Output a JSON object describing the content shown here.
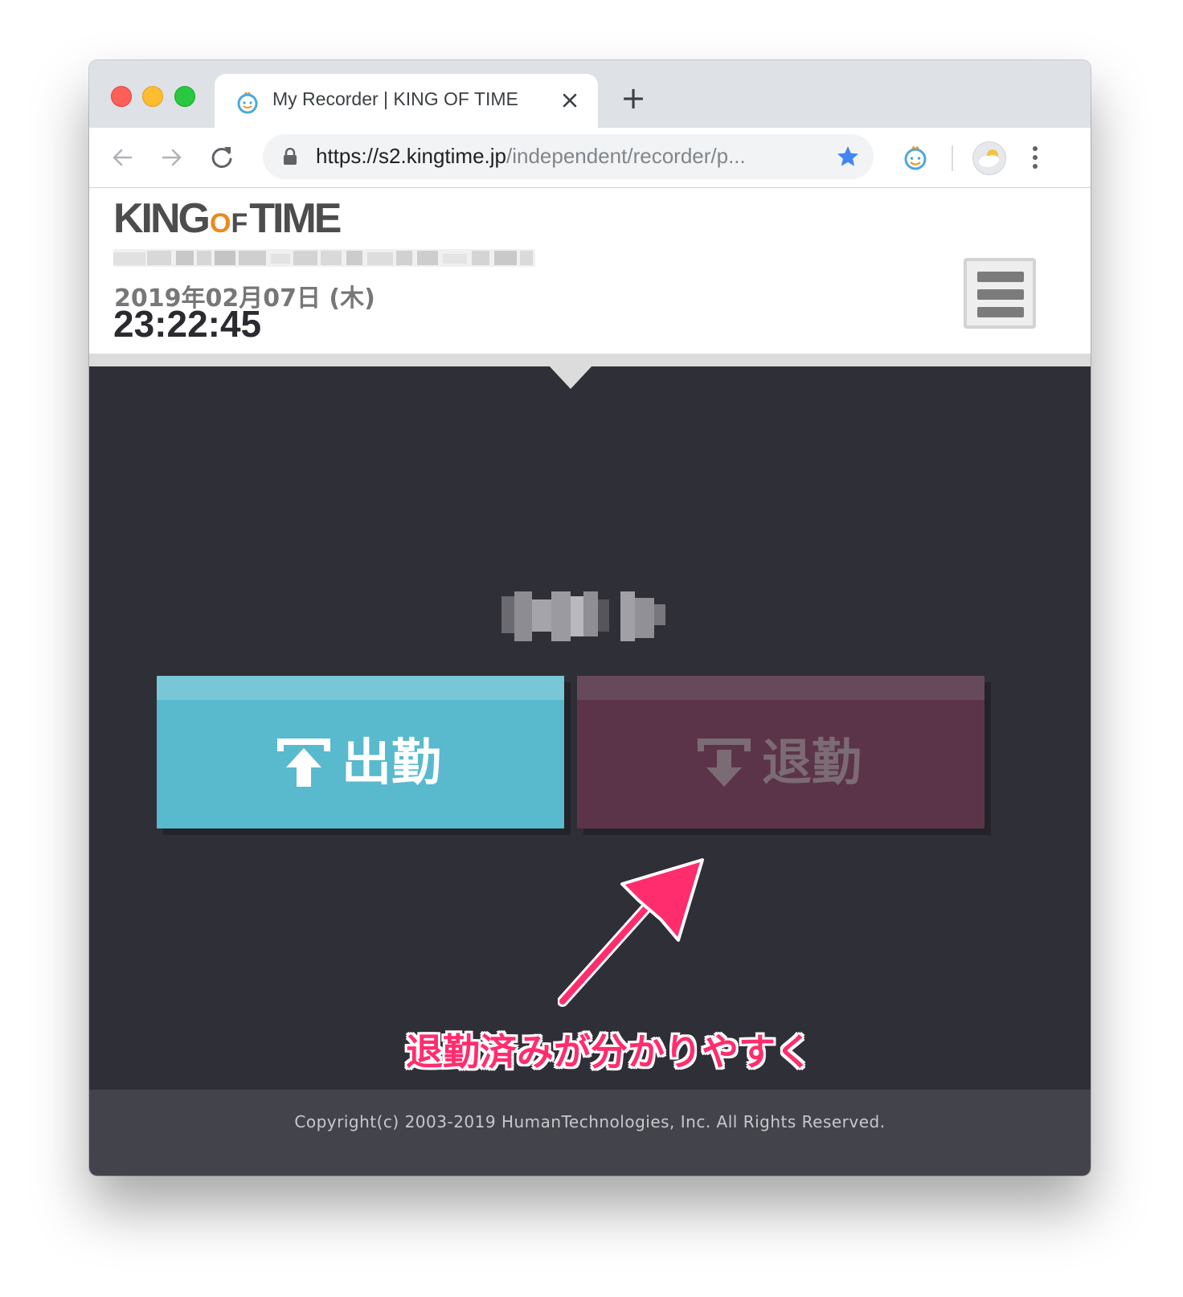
{
  "browser": {
    "tab_title": "My Recorder | KING OF TIME",
    "tab_close_icon": "close-icon",
    "new_tab_label": "+",
    "url_main": "https://s2.kingtime.jp",
    "url_path": "/independent/recorder/p...",
    "bookmark_star_color": "#4285f4"
  },
  "header": {
    "logo_king": "KING",
    "logo_of_o": "O",
    "logo_of_f": "F",
    "logo_time": "TIME",
    "date": "2019年02月07日 (木)",
    "time": "23:22:45"
  },
  "buttons": {
    "clock_in_label": "出勤",
    "clock_out_label": "退勤",
    "clock_in_color": "#59b9cd",
    "clock_out_color": "#5c3449"
  },
  "annotation": {
    "text": "退勤済みが分かりやすく",
    "color": "#ff2d6e"
  },
  "footer": {
    "copyright": "Copyright(c) 2003-2019 HumanTechnologies, Inc. All Rights Reserved."
  }
}
